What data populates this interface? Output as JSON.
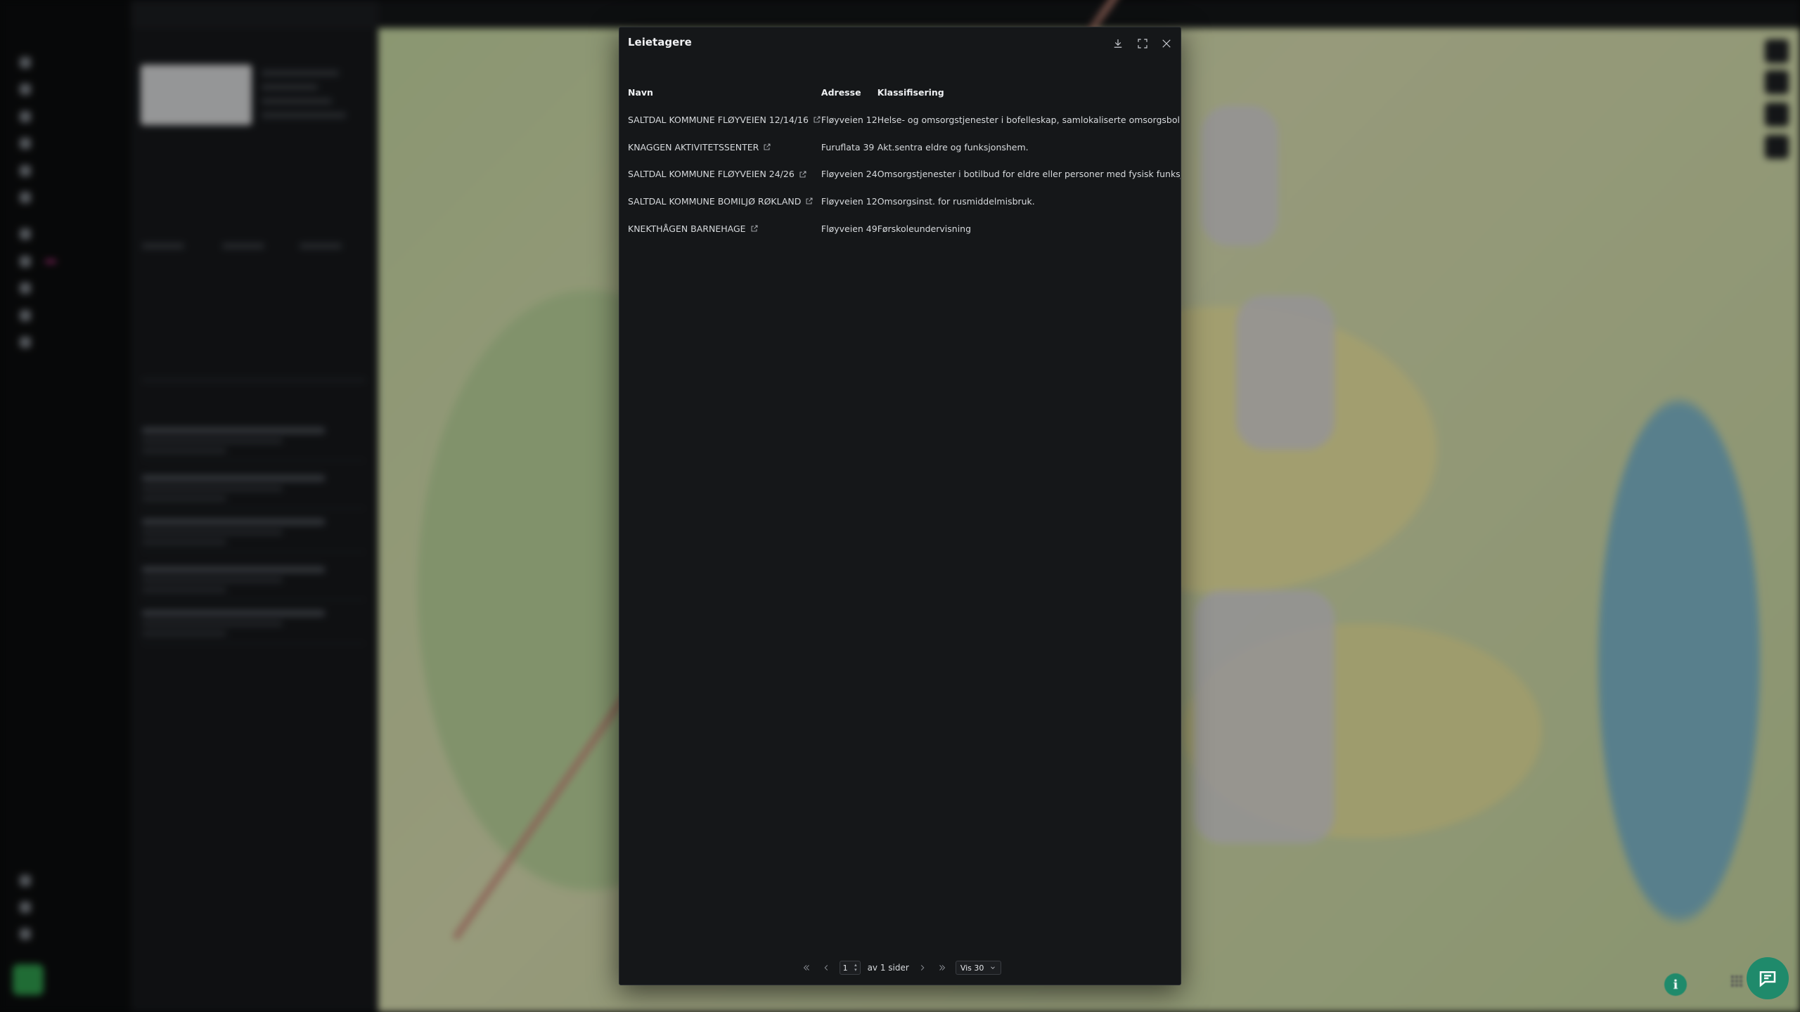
{
  "modal": {
    "title": "Leietagere",
    "columns": {
      "name": "Navn",
      "address": "Adresse",
      "classification": "Klassifisering"
    },
    "rows": [
      {
        "name": "SALTDAL KOMMUNE FLØYVEIEN 12/14/16",
        "address": "Fløyveien 12",
        "classification": "Helse- og omsorgstjenester i bofelleskap, samlokaliserte omsorgsboliger"
      },
      {
        "name": "KNAGGEN AKTIVITETSSENTER",
        "address": "Furuflata 39",
        "classification": "Akt.sentra eldre og funksjonshem."
      },
      {
        "name": "SALTDAL KOMMUNE FLØYVEIEN 24/26",
        "address": "Fløyveien 24",
        "classification": "Omsorgstjenester i botilbud for eldre eller personer med fysisk funksjonsnedsettelse"
      },
      {
        "name": "SALTDAL KOMMUNE BOMILJØ RØKLAND",
        "address": "Fløyveien 12",
        "classification": "Omsorgsinst. for rusmiddelmisbruk."
      },
      {
        "name": "KNEKTHÅGEN BARNEHAGE",
        "address": "Fløyveien 49",
        "classification": "Førskoleundervisning"
      }
    ],
    "pager": {
      "page": "1",
      "of_label": "av 1 sider",
      "page_size": "Vis 30"
    }
  },
  "icons": {
    "download": "download-icon",
    "expand": "expand-icon",
    "close": "close-icon",
    "external": "external-link-icon",
    "chat": "chat-icon",
    "info": "info-icon"
  },
  "info_label": "i"
}
